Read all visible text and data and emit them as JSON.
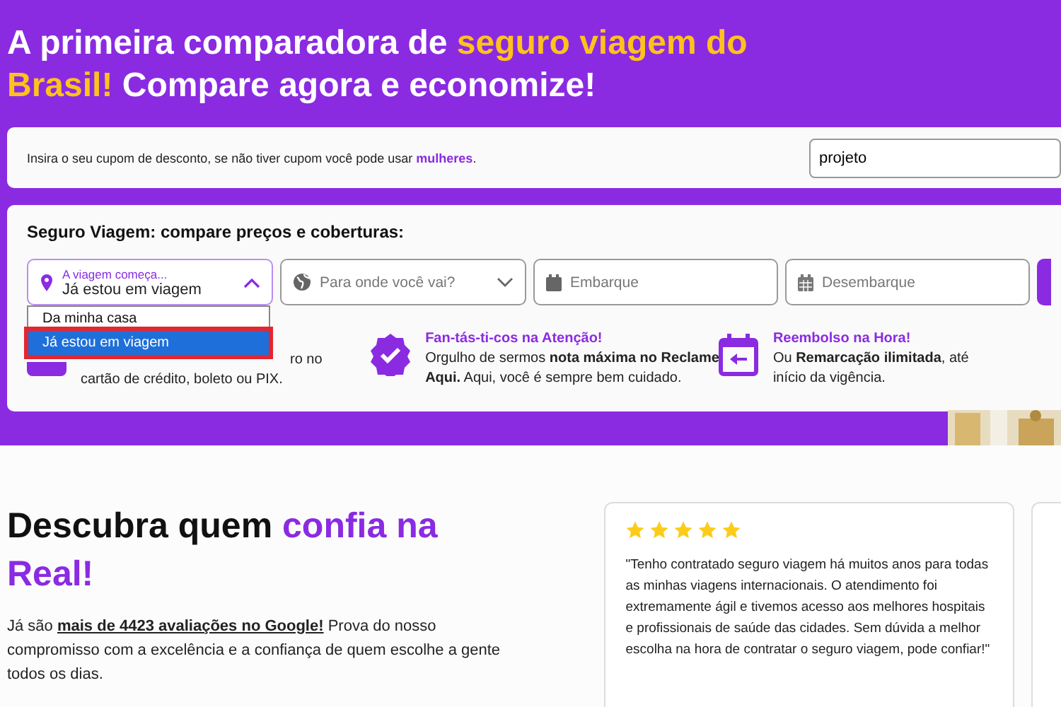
{
  "headline": "A primeira comparadora de **seguro viagem do Brasil!** Compare agora e economize!",
  "coupon": {
    "text": "Insira o seu cupom de desconto, se não tiver cupom você pode usar **mulheres**.",
    "value": "projeto"
  },
  "search": {
    "title": "Seguro Viagem: compare preços e coberturas:",
    "start": {
      "label": "A viagem começa...",
      "value": "Já estou em viagem",
      "expanded": true,
      "options": [
        {
          "label": "Da minha casa",
          "selected": false
        },
        {
          "label": "Já estou em viagem",
          "selected": true
        }
      ]
    },
    "destination": {
      "placeholder": "Para onde você vai?"
    },
    "departure": {
      "placeholder": "Embarque"
    },
    "return": {
      "placeholder": "Desembarque"
    }
  },
  "features": [
    {
      "kind": "card",
      "lines": [
        "ro no",
        "cartão de crédito, boleto ou PIX."
      ]
    },
    {
      "kind": "badge",
      "title": "Fan-tás-ti-cos na Atenção!",
      "lines": [
        "Orgulho de sermos **nota máxima no Reclame**",
        "**Aqui.** Aqui, você é sempre bem cuidado."
      ]
    },
    {
      "kind": "calendar",
      "title": "Reembolso na Hora!",
      "lines": [
        "Ou **Remarcação ilimitada**, até",
        "início da vigência."
      ]
    }
  ],
  "trust": {
    "heading": "Descubra quem **confia na Real!**",
    "paragraphs": [
      "Já são **mais de 4423 avaliações no Google!** Prova do nosso compromisso com a excelência e a confiança de quem escolhe a gente todos os dias."
    ]
  },
  "review": {
    "stars": 5,
    "text": "\"Tenho contratado seguro viagem há muitos anos para todas as minhas viagens internacionais. O atendimento foi extremamente ágil e tivemos acesso aos melhores hospitais e profissionais de saúde das cidades. Sem dúvida a melhor escolha na hora de contratar o seguro viagem, pode confiar!\""
  }
}
